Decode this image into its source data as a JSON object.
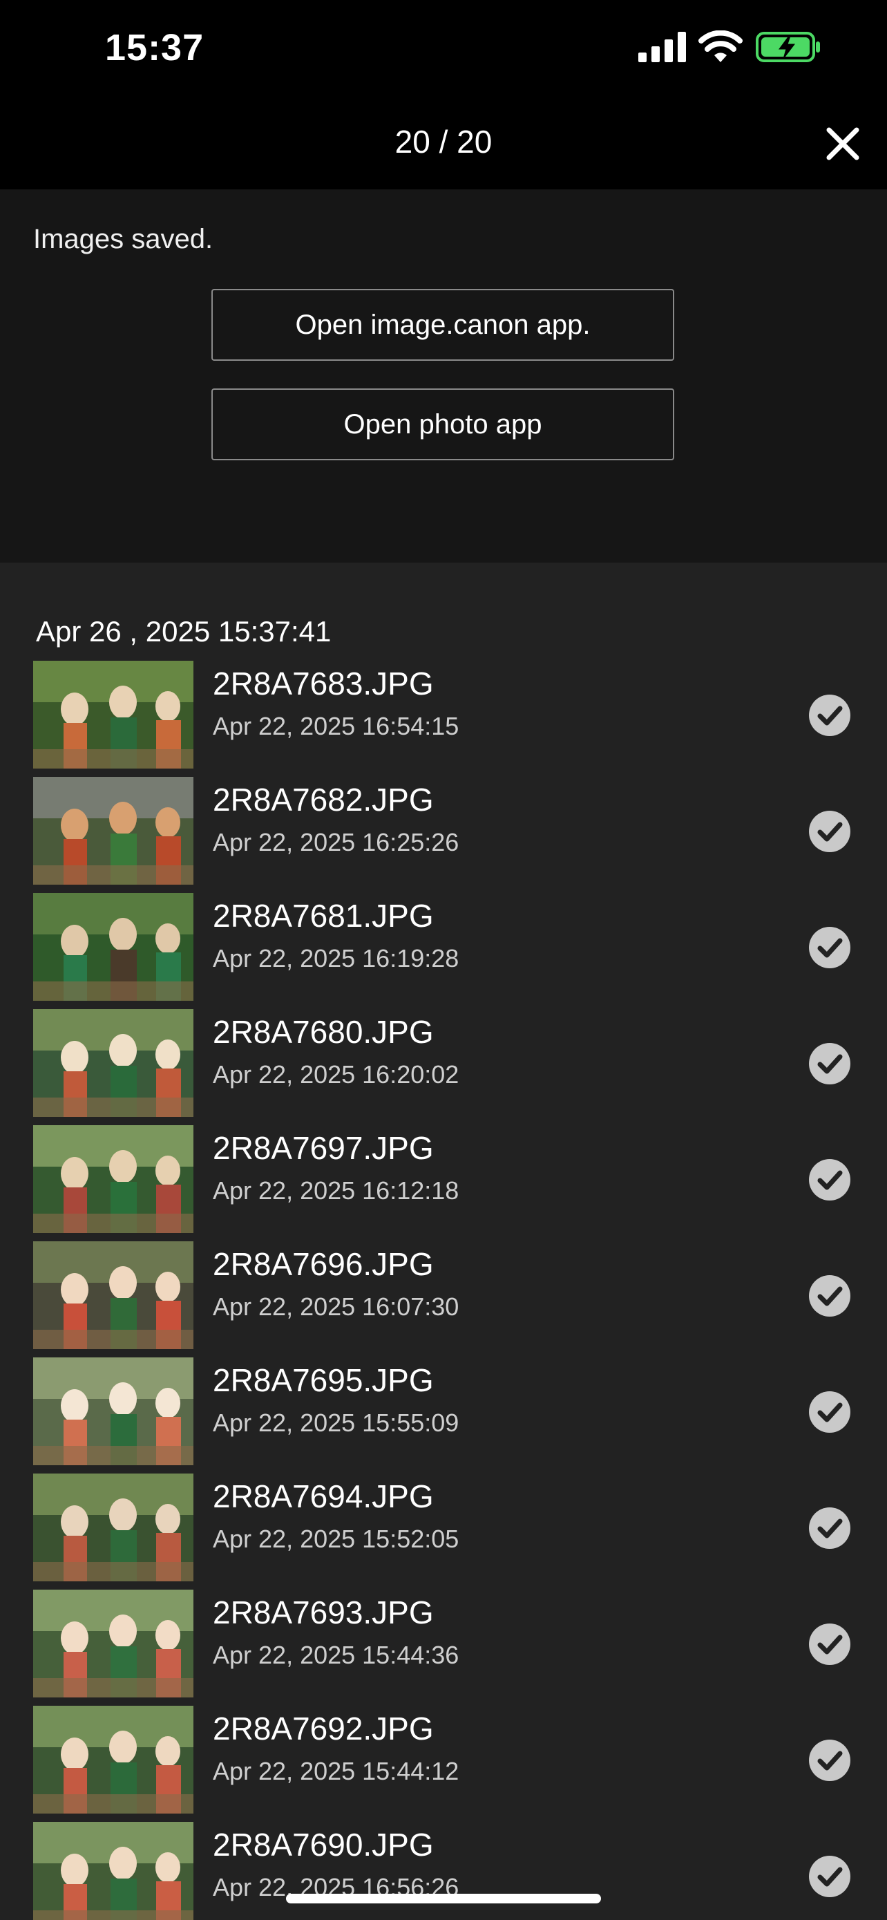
{
  "status_bar": {
    "time": "15:37",
    "battery_color": "#4cd964"
  },
  "header": {
    "counter": "20 / 20",
    "close_icon": "close-icon"
  },
  "notice": {
    "message": "Images saved.",
    "open_canon_label": "Open image.canon app.",
    "open_photo_label": "Open photo app"
  },
  "list": {
    "group_date": "Apr 26 , 2025 15:37:41",
    "items": [
      {
        "name": "2R8A7683.JPG",
        "date": "Apr 22, 2025 16:54:15"
      },
      {
        "name": "2R8A7682.JPG",
        "date": "Apr 22, 2025 16:25:26"
      },
      {
        "name": "2R8A7681.JPG",
        "date": "Apr 22, 2025 16:19:28"
      },
      {
        "name": "2R8A7680.JPG",
        "date": "Apr 22, 2025 16:20:02"
      },
      {
        "name": "2R8A7697.JPG",
        "date": "Apr 22, 2025 16:12:18"
      },
      {
        "name": "2R8A7696.JPG",
        "date": "Apr 22, 2025 16:07:30"
      },
      {
        "name": "2R8A7695.JPG",
        "date": "Apr 22, 2025 15:55:09"
      },
      {
        "name": "2R8A7694.JPG",
        "date": "Apr 22, 2025 15:52:05"
      },
      {
        "name": "2R8A7693.JPG",
        "date": "Apr 22, 2025 15:44:36"
      },
      {
        "name": "2R8A7692.JPG",
        "date": "Apr 22, 2025 15:44:12"
      },
      {
        "name": "2R8A7690.JPG",
        "date": "Apr 22, 2025 16:56:26"
      }
    ]
  }
}
